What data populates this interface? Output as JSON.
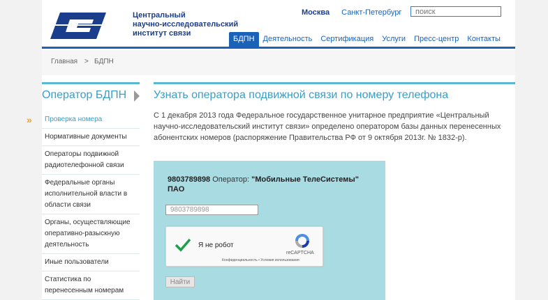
{
  "header": {
    "org_name": [
      "Центральный",
      "научно-исследовательский",
      "институт связи"
    ],
    "cities": [
      "Москва",
      "Санкт-Петербург"
    ],
    "search_placeholder": "поиск"
  },
  "nav": [
    "БДПН",
    "Деятельность",
    "Сертификация",
    "Услуги",
    "Пресс-центр",
    "Контакты"
  ],
  "breadcrumb": {
    "home": "Главная",
    "separator": ">",
    "current": "БДПН"
  },
  "sidebar": {
    "title": "Оператор БДПН",
    "items": [
      "Проверка номера",
      "Нормативные документы",
      "Операторы подвижной радиотелефонной связи",
      "Федеральные органы исполнительной власти в области связи",
      "Органы, осуществляющие оперативно-разыскную деятельность",
      "Иные пользователи",
      "Статистика по перенесенным номерам"
    ]
  },
  "content": {
    "title": "Узнать оператора подвижной связи по номеру телефона",
    "text": "С 1 декабря 2013 года Федеральное государственное унитарное предприятие «Центральный научно-исследовательский институт связи» определено оператором базы данных перенесенных абонентских номеров (распоряжение Правительства РФ от 9 октября 2013г. № 1832-р)."
  },
  "result": {
    "number": "9803789898",
    "operator_label": "Оператор:",
    "operator_name": "\"Мобильные ТелеСистемы\" ПАО",
    "input_value": "9803789898",
    "captcha_label": "Я не робот",
    "recaptcha_name": "reCAPTCHA",
    "recaptcha_links": "Конфиденциальность • Условия использования",
    "submit_label": "Найти"
  },
  "colors": {
    "brand": "#1a62b8",
    "accent": "#3a9ec7",
    "result_bg": "#a9dbe3",
    "chevrons": "#f0a020"
  }
}
